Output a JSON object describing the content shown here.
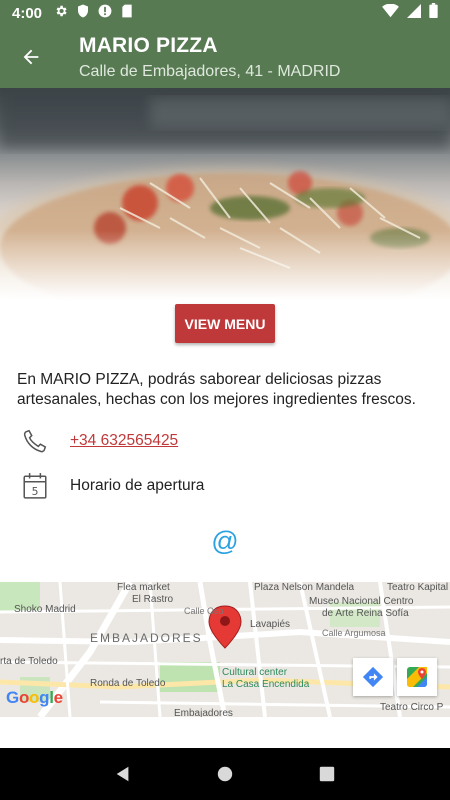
{
  "status_bar": {
    "time": "4:00",
    "icons_left": [
      "settings-icon",
      "shield-icon",
      "alert-icon",
      "sd-card-icon"
    ],
    "icons_right": [
      "wifi-icon",
      "signal-icon",
      "battery-icon"
    ]
  },
  "app_bar": {
    "title": "MARIO PIZZA",
    "subtitle": "Calle de Embajadores, 41 - MADRID",
    "background": "#577a52"
  },
  "view_menu_label": "VIEW MENU",
  "description": "En MARIO PIZZA, podrás saborear deliciosas pizzas artesanales, hechas con los mejores ingredientes frescos.",
  "phone": "+34 632565425",
  "hours_label": "Horario de apertura",
  "email_symbol": "@",
  "map": {
    "labels": {
      "flea_market": "Flea market",
      "el_rastro": "El Rastro",
      "plaza_nelson": "Plaza Nelson Mandela",
      "teatro_kapital": "Teatro Kapital",
      "shoko": "Shoko Madrid",
      "museo_1": "Museo Nacional Centro",
      "museo_2": "de Arte Reina Sofía",
      "embajadores": "EMBAJADORES",
      "lavapies": "Lavapiés",
      "calle_argumosa": "Calle Argumosa",
      "puerta_toledo": "rta de Toledo",
      "ronda_toledo": "Ronda de Toledo",
      "cultural_1": "Cultural center",
      "cultural_2": "La Casa Encendida",
      "embajadores_station": "Embajadores",
      "teatro_circo": "Teatro Circo P",
      "calle_oso": "Calle Oso",
      "google": "Google"
    }
  },
  "colors": {
    "accent_red": "#c0393a",
    "at_blue": "#2aa1e0",
    "pin_red": "#e53935"
  }
}
